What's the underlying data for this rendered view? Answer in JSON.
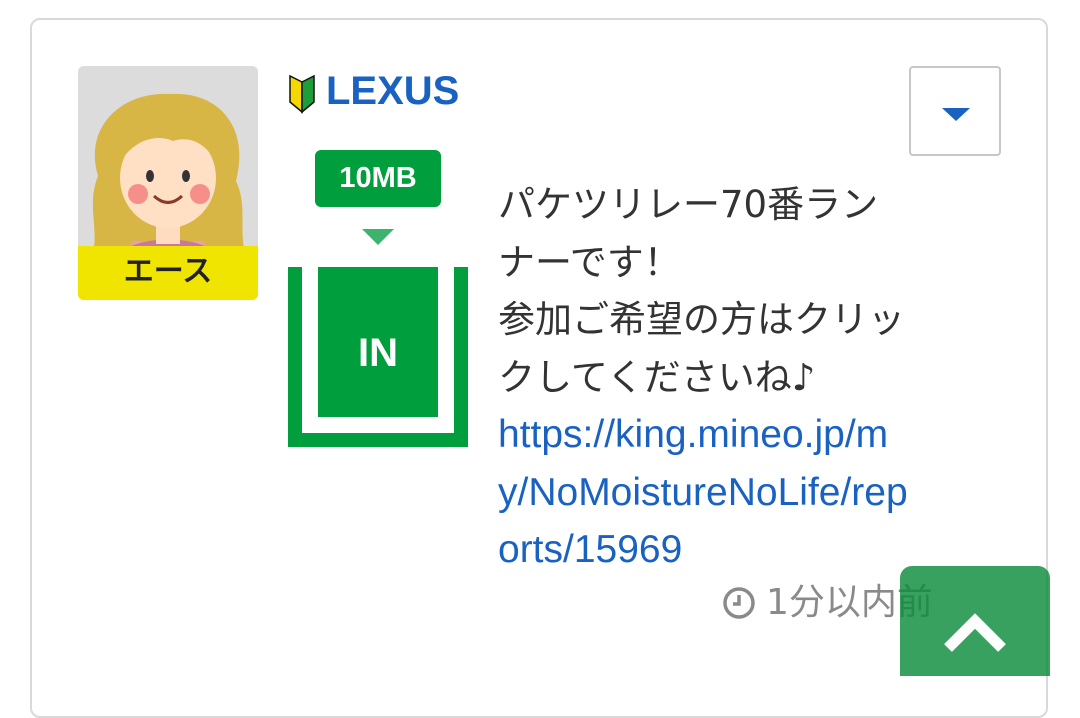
{
  "post": {
    "author": {
      "name": "LEXUS",
      "rank": "エース",
      "avatar": "avatar-blonde-girl",
      "badge_icon": "beginner-mark-icon"
    },
    "transfer": {
      "amount": "10MB",
      "direction": "IN"
    },
    "message_lines": [
      "パケツリレー70番ラン",
      "ナーです！",
      "参加ご希望の方はクリッ",
      "クしてくださいね♪"
    ],
    "link_lines": [
      "https://king.mineo.jp/m",
      "y/NoMoistureNoLife/rep",
      "orts/15969"
    ],
    "timestamp": "1分以内前"
  },
  "colors": {
    "brand_green": "#009e3d",
    "link_blue": "#1a62c2",
    "rank_yellow": "#f0e500"
  },
  "icons": {
    "menu": "chevron-down-icon",
    "time": "clock-icon",
    "scroll": "chevron-up-icon"
  }
}
